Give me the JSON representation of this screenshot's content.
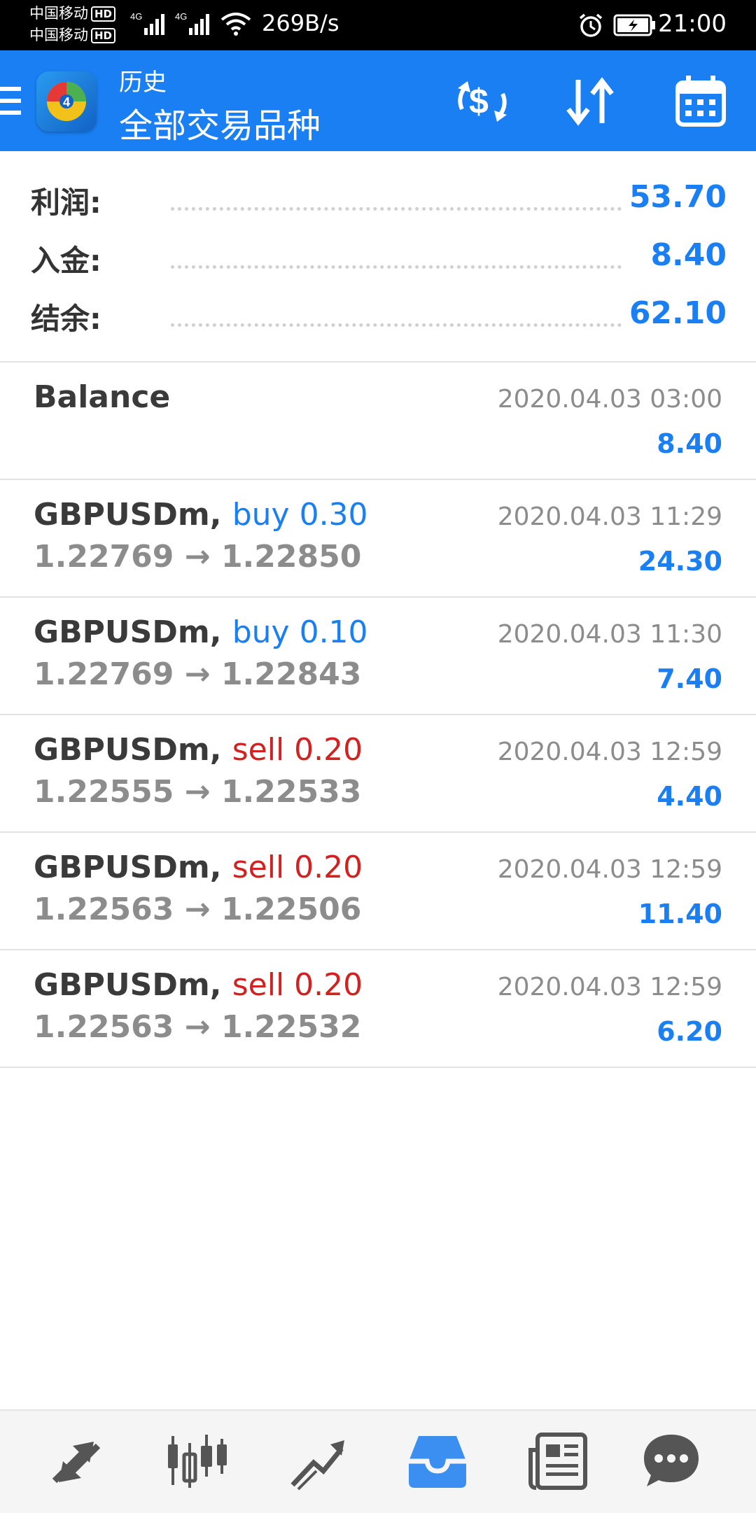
{
  "status_bar": {
    "carrier1": "中国移动",
    "carrier2": "中国移动",
    "hd_badge": "HD",
    "network_type": "4G",
    "net_speed": "269B/s",
    "time": "21:00"
  },
  "toolbar": {
    "title": "历史",
    "subtitle": "全部交易品种",
    "bg_color": "#1a7ff2"
  },
  "summary": {
    "profit": {
      "label": "利润:",
      "value": "53.70"
    },
    "deposit": {
      "label": "入金:",
      "value": "8.40"
    },
    "balance": {
      "label": "结余:",
      "value": "62.10"
    }
  },
  "balance_entry": {
    "label": "Balance",
    "time": "2020.04.03 03:00",
    "amount": "8.40"
  },
  "deals": [
    {
      "symbol": "GBPUSDm,",
      "side": "buy",
      "side_text": "buy 0.30",
      "open": "1.22769",
      "arrow": "→",
      "close": "1.22850",
      "time": "2020.04.03 11:29",
      "profit": "24.30"
    },
    {
      "symbol": "GBPUSDm,",
      "side": "buy",
      "side_text": "buy 0.10",
      "open": "1.22769",
      "arrow": "→",
      "close": "1.22843",
      "time": "2020.04.03 11:30",
      "profit": "7.40"
    },
    {
      "symbol": "GBPUSDm,",
      "side": "sell",
      "side_text": "sell 0.20",
      "open": "1.22555",
      "arrow": "→",
      "close": "1.22533",
      "time": "2020.04.03 12:59",
      "profit": "4.40"
    },
    {
      "symbol": "GBPUSDm,",
      "side": "sell",
      "side_text": "sell 0.20",
      "open": "1.22563",
      "arrow": "→",
      "close": "1.22506",
      "time": "2020.04.03 12:59",
      "profit": "11.40"
    },
    {
      "symbol": "GBPUSDm,",
      "side": "sell",
      "side_text": "sell 0.20",
      "open": "1.22563",
      "arrow": "→",
      "close": "1.22532",
      "time": "2020.04.03 12:59",
      "profit": "6.20"
    }
  ],
  "icons": {
    "toolbar": [
      "menu-icon",
      "metatrader-logo-icon",
      "currency-exchange-icon",
      "sort-icon",
      "calendar-icon"
    ],
    "bottom_nav": [
      "trade-arrows-icon",
      "candlestick-icon",
      "chart-line-icon",
      "history-inbox-icon",
      "news-icon",
      "chat-icon"
    ]
  },
  "colors": {
    "accent": "#1a7ff2",
    "sell": "#d32020",
    "muted": "#8c8c8c",
    "active_nav": "#3b8ff0",
    "inactive_nav": "#555555"
  }
}
